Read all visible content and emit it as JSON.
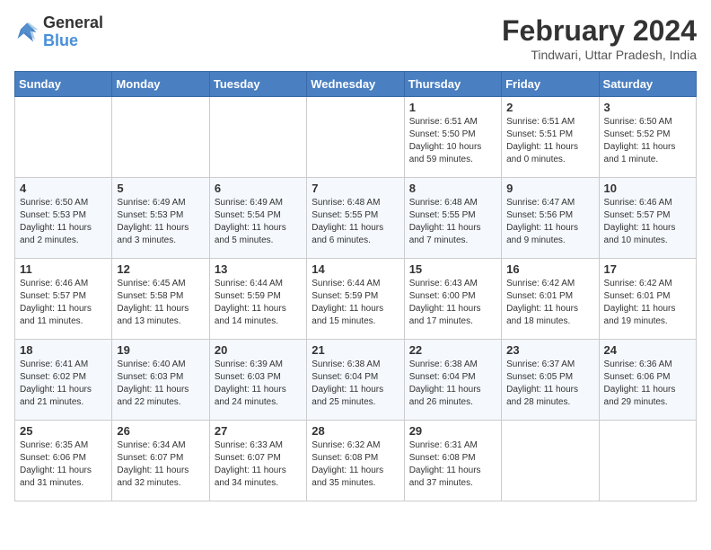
{
  "logo": {
    "general": "General",
    "blue": "Blue"
  },
  "title": "February 2024",
  "subtitle": "Tindwari, Uttar Pradesh, India",
  "weekdays": [
    "Sunday",
    "Monday",
    "Tuesday",
    "Wednesday",
    "Thursday",
    "Friday",
    "Saturday"
  ],
  "weeks": [
    [
      {
        "day": "",
        "info": ""
      },
      {
        "day": "",
        "info": ""
      },
      {
        "day": "",
        "info": ""
      },
      {
        "day": "",
        "info": ""
      },
      {
        "day": "1",
        "info": "Sunrise: 6:51 AM\nSunset: 5:50 PM\nDaylight: 10 hours and 59 minutes."
      },
      {
        "day": "2",
        "info": "Sunrise: 6:51 AM\nSunset: 5:51 PM\nDaylight: 11 hours and 0 minutes."
      },
      {
        "day": "3",
        "info": "Sunrise: 6:50 AM\nSunset: 5:52 PM\nDaylight: 11 hours and 1 minute."
      }
    ],
    [
      {
        "day": "4",
        "info": "Sunrise: 6:50 AM\nSunset: 5:53 PM\nDaylight: 11 hours and 2 minutes."
      },
      {
        "day": "5",
        "info": "Sunrise: 6:49 AM\nSunset: 5:53 PM\nDaylight: 11 hours and 3 minutes."
      },
      {
        "day": "6",
        "info": "Sunrise: 6:49 AM\nSunset: 5:54 PM\nDaylight: 11 hours and 5 minutes."
      },
      {
        "day": "7",
        "info": "Sunrise: 6:48 AM\nSunset: 5:55 PM\nDaylight: 11 hours and 6 minutes."
      },
      {
        "day": "8",
        "info": "Sunrise: 6:48 AM\nSunset: 5:55 PM\nDaylight: 11 hours and 7 minutes."
      },
      {
        "day": "9",
        "info": "Sunrise: 6:47 AM\nSunset: 5:56 PM\nDaylight: 11 hours and 9 minutes."
      },
      {
        "day": "10",
        "info": "Sunrise: 6:46 AM\nSunset: 5:57 PM\nDaylight: 11 hours and 10 minutes."
      }
    ],
    [
      {
        "day": "11",
        "info": "Sunrise: 6:46 AM\nSunset: 5:57 PM\nDaylight: 11 hours and 11 minutes."
      },
      {
        "day": "12",
        "info": "Sunrise: 6:45 AM\nSunset: 5:58 PM\nDaylight: 11 hours and 13 minutes."
      },
      {
        "day": "13",
        "info": "Sunrise: 6:44 AM\nSunset: 5:59 PM\nDaylight: 11 hours and 14 minutes."
      },
      {
        "day": "14",
        "info": "Sunrise: 6:44 AM\nSunset: 5:59 PM\nDaylight: 11 hours and 15 minutes."
      },
      {
        "day": "15",
        "info": "Sunrise: 6:43 AM\nSunset: 6:00 PM\nDaylight: 11 hours and 17 minutes."
      },
      {
        "day": "16",
        "info": "Sunrise: 6:42 AM\nSunset: 6:01 PM\nDaylight: 11 hours and 18 minutes."
      },
      {
        "day": "17",
        "info": "Sunrise: 6:42 AM\nSunset: 6:01 PM\nDaylight: 11 hours and 19 minutes."
      }
    ],
    [
      {
        "day": "18",
        "info": "Sunrise: 6:41 AM\nSunset: 6:02 PM\nDaylight: 11 hours and 21 minutes."
      },
      {
        "day": "19",
        "info": "Sunrise: 6:40 AM\nSunset: 6:03 PM\nDaylight: 11 hours and 22 minutes."
      },
      {
        "day": "20",
        "info": "Sunrise: 6:39 AM\nSunset: 6:03 PM\nDaylight: 11 hours and 24 minutes."
      },
      {
        "day": "21",
        "info": "Sunrise: 6:38 AM\nSunset: 6:04 PM\nDaylight: 11 hours and 25 minutes."
      },
      {
        "day": "22",
        "info": "Sunrise: 6:38 AM\nSunset: 6:04 PM\nDaylight: 11 hours and 26 minutes."
      },
      {
        "day": "23",
        "info": "Sunrise: 6:37 AM\nSunset: 6:05 PM\nDaylight: 11 hours and 28 minutes."
      },
      {
        "day": "24",
        "info": "Sunrise: 6:36 AM\nSunset: 6:06 PM\nDaylight: 11 hours and 29 minutes."
      }
    ],
    [
      {
        "day": "25",
        "info": "Sunrise: 6:35 AM\nSunset: 6:06 PM\nDaylight: 11 hours and 31 minutes."
      },
      {
        "day": "26",
        "info": "Sunrise: 6:34 AM\nSunset: 6:07 PM\nDaylight: 11 hours and 32 minutes."
      },
      {
        "day": "27",
        "info": "Sunrise: 6:33 AM\nSunset: 6:07 PM\nDaylight: 11 hours and 34 minutes."
      },
      {
        "day": "28",
        "info": "Sunrise: 6:32 AM\nSunset: 6:08 PM\nDaylight: 11 hours and 35 minutes."
      },
      {
        "day": "29",
        "info": "Sunrise: 6:31 AM\nSunset: 6:08 PM\nDaylight: 11 hours and 37 minutes."
      },
      {
        "day": "",
        "info": ""
      },
      {
        "day": "",
        "info": ""
      }
    ]
  ]
}
